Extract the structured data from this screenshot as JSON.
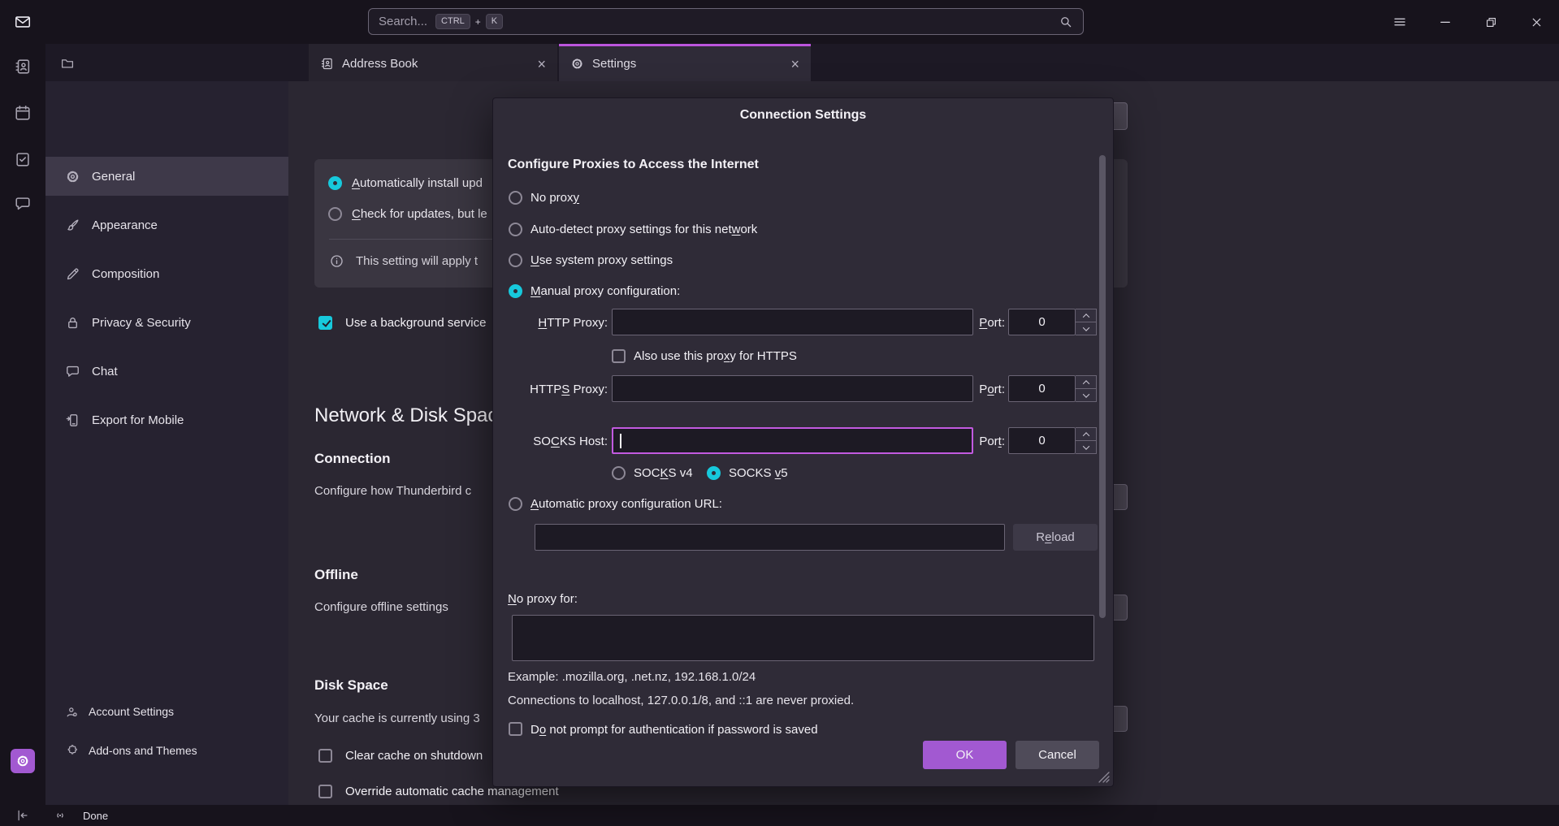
{
  "colors": {
    "accent_cyan": "#17c9dc",
    "accent_purple": "#a259d1",
    "focus_purple": "#c25ae0",
    "tab_accent": "#bc55dd"
  },
  "topbar": {
    "search_placeholder": "Search...",
    "shortcut_ctrl": "CTRL",
    "shortcut_plus": "+",
    "shortcut_k": "K"
  },
  "tabs": [
    {
      "label": "Address Book"
    },
    {
      "label": "Settings"
    }
  ],
  "nav": {
    "items": [
      {
        "label": "General"
      },
      {
        "label": "Appearance"
      },
      {
        "label": "Composition"
      },
      {
        "label": "Privacy & Security"
      },
      {
        "label": "Chat"
      },
      {
        "label": "Export for Mobile"
      }
    ],
    "footer": [
      {
        "label": "Account Settings"
      },
      {
        "label": "Add-ons and Themes"
      }
    ]
  },
  "content": {
    "update_option_1": {
      "text": "Automatically install upd",
      "u": 0
    },
    "update_option_2": {
      "text": "Check for updates, but le",
      "u": 0
    },
    "update_note": "This setting will apply t",
    "background_service": "Use a background service",
    "section_network": "Network & Disk Space",
    "connection_heading": "Connection",
    "connection_desc": "Configure how Thunderbird c",
    "offline_heading": "Offline",
    "offline_desc": "Configure offline settings",
    "diskspace_heading": "Disk Space",
    "cache_text": "Your cache is currently using 3",
    "clear_cache": "Clear cache on shutdown",
    "override_cache": "Override automatic cache management"
  },
  "dialog": {
    "title": "Connection Settings",
    "heading": "Configure Proxies to Access the Internet",
    "no_proxy": {
      "text": "No proxy",
      "u": 7
    },
    "auto_detect": {
      "text": "Auto-detect proxy settings for this network",
      "u": 39
    },
    "system_proxy": {
      "text": "Use system proxy settings",
      "u": 0
    },
    "manual_proxy": {
      "text": "Manual proxy configuration:",
      "u": 0
    },
    "http_label": {
      "text": "HTTP Proxy:",
      "u": 0
    },
    "port1_label": {
      "text": "Port:",
      "u": 0
    },
    "port1_value": "0",
    "also_https": {
      "text": "Also use this proxy for HTTPS",
      "u": 17
    },
    "https_label": {
      "text": "HTTPS Proxy:",
      "u": 4
    },
    "port2_label": {
      "text": "Port:",
      "u": 1
    },
    "port2_value": "0",
    "socks_label": {
      "text": "SOCKS Host:",
      "u": 2
    },
    "socks_value": "",
    "port3_label": {
      "text": "Port:",
      "u": 3
    },
    "port3_value": "0",
    "socks_v4": {
      "text": "SOCKS v4",
      "u": 3
    },
    "socks_v5": {
      "text": "SOCKS v5",
      "u": 6
    },
    "auto_url": {
      "text": "Automatic proxy configuration URL:",
      "u": 0
    },
    "url_value": "",
    "reload": {
      "text": "Reload",
      "u": 1
    },
    "no_proxy_for": {
      "text": "No proxy for:",
      "u": 0
    },
    "no_proxy_for_value": "",
    "example": "Example: .mozilla.org, .net.nz, 192.168.1.0/24",
    "localhost_note": "Connections to localhost, 127.0.0.1/8, and ::1 are never proxied.",
    "no_prompt": {
      "text": "Do not prompt for authentication if password is saved",
      "u": 1
    },
    "ok": "OK",
    "cancel": "Cancel"
  },
  "statusbar": {
    "text": "Done"
  }
}
